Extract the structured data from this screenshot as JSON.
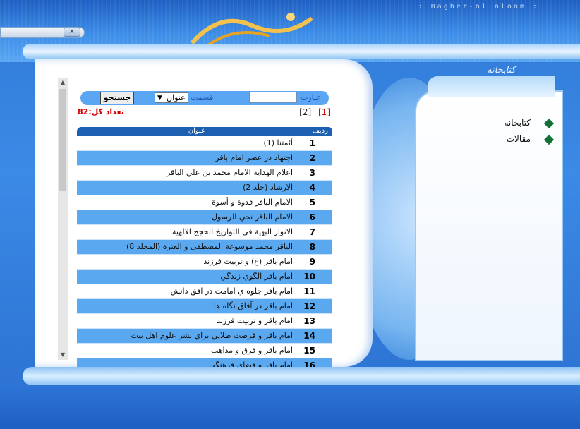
{
  "header": {
    "site_name": ": Bagher-ol oloom :",
    "logo_text": "باقر العلوم",
    "close_label": "x"
  },
  "search": {
    "label_ibarat": "عبارت",
    "query_value": "",
    "label_qesmat": "قسمت",
    "section_value": "عنوان",
    "search_button": "جستجو"
  },
  "results": {
    "total_label": "تعداد کل:82",
    "pages": [
      {
        "label": "[1]",
        "current": true
      },
      {
        "label": "[2]",
        "current": false
      }
    ],
    "header": {
      "radif": "ردیف",
      "title": "عنوان"
    },
    "rows": [
      {
        "num": "1",
        "title": "أئمتنا (1)"
      },
      {
        "num": "2",
        "title": "اجتهاد در عصر امام باقر"
      },
      {
        "num": "3",
        "title": "اعلام الهداية الامام محمد بن علي الباقر"
      },
      {
        "num": "4",
        "title": "الارشاد (جلد 2)"
      },
      {
        "num": "5",
        "title": "الامام الباقر قدوة و أسوة"
      },
      {
        "num": "6",
        "title": "الامام الباقر نجي الرسول"
      },
      {
        "num": "7",
        "title": "الانوار البهية في التواريخ الحجج الالهية"
      },
      {
        "num": "8",
        "title": "الباقر محمد موسوعة المصطفى و العترة (المجلد 8)"
      },
      {
        "num": "9",
        "title": "امام باقر (ع) و تربيت فرزند"
      },
      {
        "num": "10",
        "title": "امام باقر الگوي زندگي"
      },
      {
        "num": "11",
        "title": "امام باقر جلوه ي امامت در افق دانش"
      },
      {
        "num": "12",
        "title": "امام باقر در آفاق نگاه ها"
      },
      {
        "num": "13",
        "title": "امام باقر و تربيت فرزند"
      },
      {
        "num": "14",
        "title": "امام باقر و فرصت طلايي براي نشر علوم اهل بيت"
      },
      {
        "num": "15",
        "title": "امام باقر و فرق و مذاهب"
      },
      {
        "num": "16",
        "title": "امام باقر و فضاي فرهنگي"
      }
    ]
  },
  "sidebar": {
    "title": "کتابخانه",
    "items": [
      {
        "label": "کتابخانه"
      },
      {
        "label": "مقالات"
      }
    ]
  },
  "colors": {
    "accent": "#3b8ae6",
    "row_alt": "#5aa8f0",
    "total_red": "#d00000",
    "table_header": "#1d5fb0"
  }
}
